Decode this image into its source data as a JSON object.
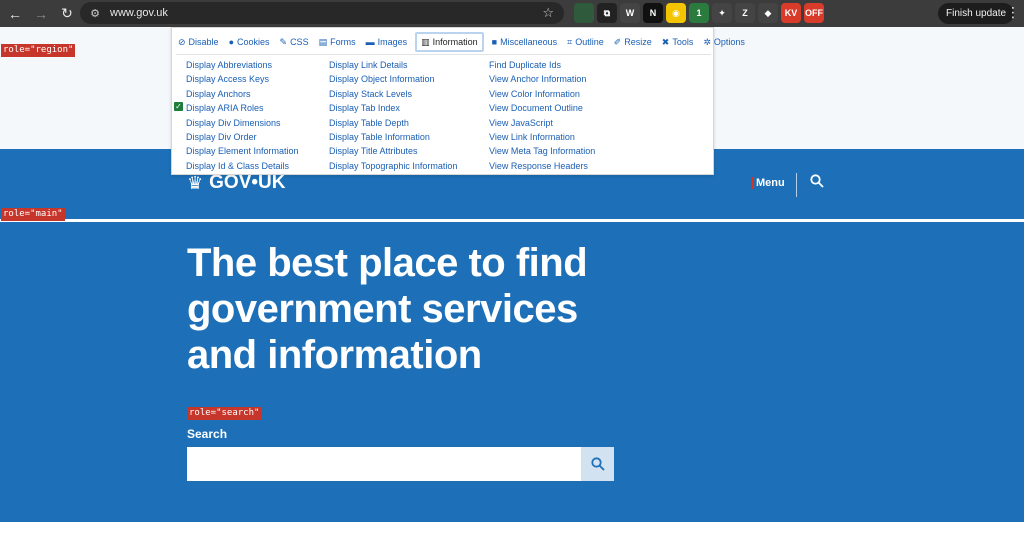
{
  "browser": {
    "url": "www.gov.uk",
    "finish_update": "Finish update",
    "extensions": [
      {
        "label": "",
        "color": "#2f5a3c"
      },
      {
        "label": "⧉",
        "color": "#222222"
      },
      {
        "label": "W",
        "color": "#444444"
      },
      {
        "label": "N",
        "color": "#111111"
      },
      {
        "label": "◉",
        "color": "#f3c400"
      },
      {
        "label": "1",
        "color": "#2b7b3f"
      },
      {
        "label": "✦",
        "color": "#444444"
      },
      {
        "label": "Z",
        "color": "#444444"
      },
      {
        "label": "◆",
        "color": "#444444"
      },
      {
        "label": "KV",
        "color": "#d83b2a"
      },
      {
        "label": "OFF",
        "color": "#d83b2a"
      }
    ]
  },
  "roles": {
    "region": "role=\"region\"",
    "main": "role=\"main\"",
    "search": "role=\"search\""
  },
  "toolbar": {
    "tabs": [
      {
        "label": "Disable",
        "icon": "⊘"
      },
      {
        "label": "Cookies",
        "icon": "●"
      },
      {
        "label": "CSS",
        "icon": "✎"
      },
      {
        "label": "Forms",
        "icon": "▤"
      },
      {
        "label": "Images",
        "icon": "▬"
      },
      {
        "label": "Information",
        "icon": "▥"
      },
      {
        "label": "Miscellaneous",
        "icon": "■"
      },
      {
        "label": "Outline",
        "icon": "⌗"
      },
      {
        "label": "Resize",
        "icon": "✐"
      },
      {
        "label": "Tools",
        "icon": "✖"
      },
      {
        "label": "Options",
        "icon": "✲"
      }
    ],
    "columns": [
      [
        "Display Abbreviations",
        "Display Access Keys",
        "Display Anchors",
        "Display ARIA Roles",
        "Display Div Dimensions",
        "Display Div Order",
        "Display Element Information",
        "Display Id & Class Details"
      ],
      [
        "Display Link Details",
        "Display Object Information",
        "Display Stack Levels",
        "Display Tab Index",
        "Display Table Depth",
        "Display Table Information",
        "Display Title Attributes",
        "Display Topographic Information"
      ],
      [
        "Find Duplicate Ids",
        "View Anchor Information",
        "View Color Information",
        "View Document Outline",
        "View JavaScript",
        "View Link Information",
        "View Meta Tag Information",
        "View Response Headers"
      ]
    ]
  },
  "header": {
    "logo_text": "GOV•UK",
    "menu_label": "Menu"
  },
  "hero": {
    "title": "The best place to find government services and information",
    "search_label": "Search",
    "search_value": ""
  },
  "colors": {
    "brand_blue": "#1d70b8",
    "role_badge": "#c6362a",
    "check": "#1e7d3a"
  }
}
